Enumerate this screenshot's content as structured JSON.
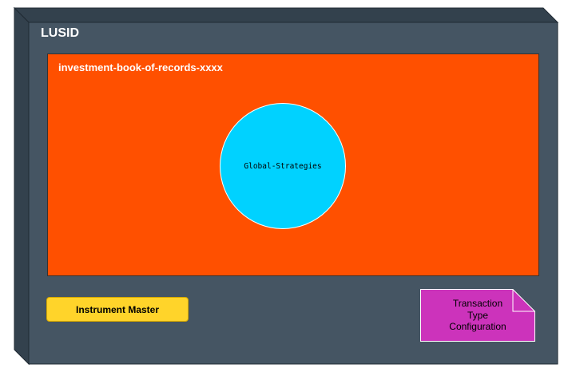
{
  "diagram": {
    "platform": {
      "title": "LUSID"
    },
    "ibor": {
      "title": "investment-book-of-records-xxxx"
    },
    "strategy": {
      "label": "Global-Strategies"
    },
    "instrument_master": {
      "label": "Instrument Master"
    },
    "transaction_config": {
      "lines": [
        "Transaction",
        "Type",
        "Configuration"
      ]
    }
  },
  "colors": {
    "platform_front": "#455563",
    "platform_side": "#33414d",
    "platform_top": "#33414d",
    "ibor_fill": "#ff5000",
    "strategy_fill": "#00d2ff",
    "instrument_fill": "#ffd42a",
    "note_fill": "#cc33bb"
  }
}
